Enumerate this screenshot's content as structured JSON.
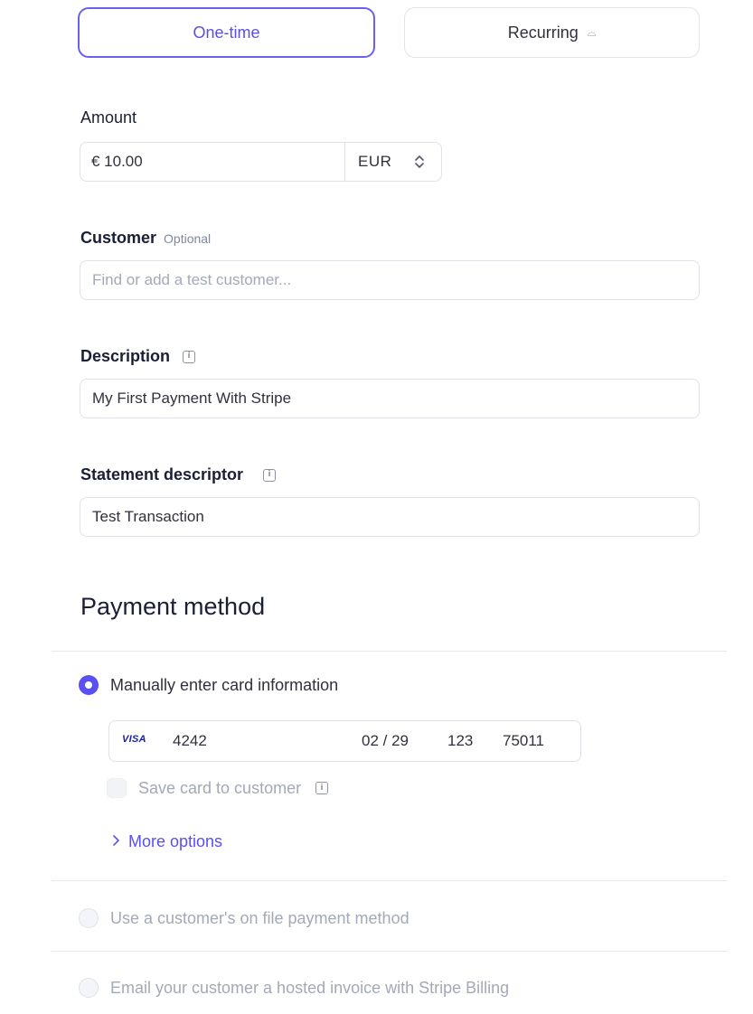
{
  "payment_type": {
    "one_time": "One-time",
    "recurring": "Recurring",
    "recurring_icon": "⌓"
  },
  "amount": {
    "label": "Amount",
    "value": "€ 10.00",
    "currency": "EUR"
  },
  "customer": {
    "label": "Customer",
    "optional": "Optional",
    "placeholder": "Find or add a test customer..."
  },
  "description": {
    "label": "Description",
    "value": "My First Payment With Stripe"
  },
  "statement_descriptor": {
    "label": "Statement descriptor",
    "value": "Test Transaction"
  },
  "payment_method": {
    "heading": "Payment method",
    "options": [
      {
        "label": "Manually enter card information",
        "selected": true
      },
      {
        "label": "Use a customer's on file payment method",
        "selected": false
      },
      {
        "label": "Email your customer a hosted invoice with Stripe Billing",
        "selected": false
      }
    ],
    "card": {
      "brand": "VISA",
      "number": "4242",
      "expiry": "02 / 29",
      "cvc": "123",
      "zip": "75011"
    },
    "save_card": "Save card to customer",
    "more_options": "More options"
  },
  "colors": {
    "accent": "#5a4ff0",
    "muted": "#a3a9b5",
    "border": "#dfe1e7"
  }
}
